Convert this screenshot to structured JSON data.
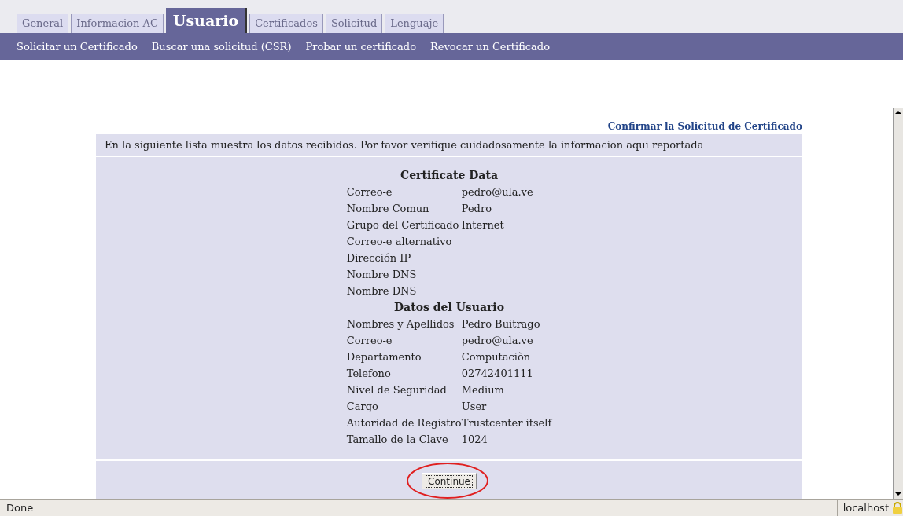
{
  "tabs": [
    {
      "label": "General",
      "selected": false
    },
    {
      "label": "Informacion AC",
      "selected": false
    },
    {
      "label": "Usuario",
      "selected": true
    },
    {
      "label": "Certificados",
      "selected": false
    },
    {
      "label": "Solicitud",
      "selected": false
    },
    {
      "label": "Lenguaje",
      "selected": false
    }
  ],
  "subnav": [
    "Solicitar un Certificado",
    "Buscar una solicitud (CSR)",
    "Probar un certificado",
    "Revocar un Certificado"
  ],
  "page_title": "Confirmar la Solicitud de Certificado",
  "intro": "En la siguiente lista muestra los datos recibidos. Por favor verifique cuidadosamente la informacion aqui reportada",
  "sections": [
    {
      "title": "Certificate Data",
      "fields": [
        {
          "label": "Correo-e",
          "value": "pedro@ula.ve"
        },
        {
          "label": "Nombre Comun",
          "value": "Pedro"
        },
        {
          "label": "Grupo del Certificado",
          "value": "Internet"
        },
        {
          "label": "Correo-e alternativo"
        },
        {
          "label": "Dirección IP"
        },
        {
          "label": "Nombre DNS"
        },
        {
          "label": "Nombre DNS"
        }
      ]
    },
    {
      "title": "Datos del Usuario",
      "fields": [
        {
          "label": "Nombres y Apellidos",
          "value": "Pedro Buitrago"
        },
        {
          "label": "Correo-e",
          "value": "pedro@ula.ve"
        },
        {
          "label": "Departamento",
          "value": "Computaciòn"
        },
        {
          "label": "Telefono",
          "value": "02742401111"
        },
        {
          "label": "Nivel de Seguridad",
          "value": "Medium"
        },
        {
          "label": "Cargo",
          "value": "User"
        },
        {
          "label": "Autoridad de Registro",
          "value": "Trustcenter itself"
        },
        {
          "label": "Tamallo de la Clave",
          "value": "1024"
        }
      ]
    }
  ],
  "button": "Continue",
  "status_bar": {
    "text": "Done",
    "host": "localhost"
  }
}
